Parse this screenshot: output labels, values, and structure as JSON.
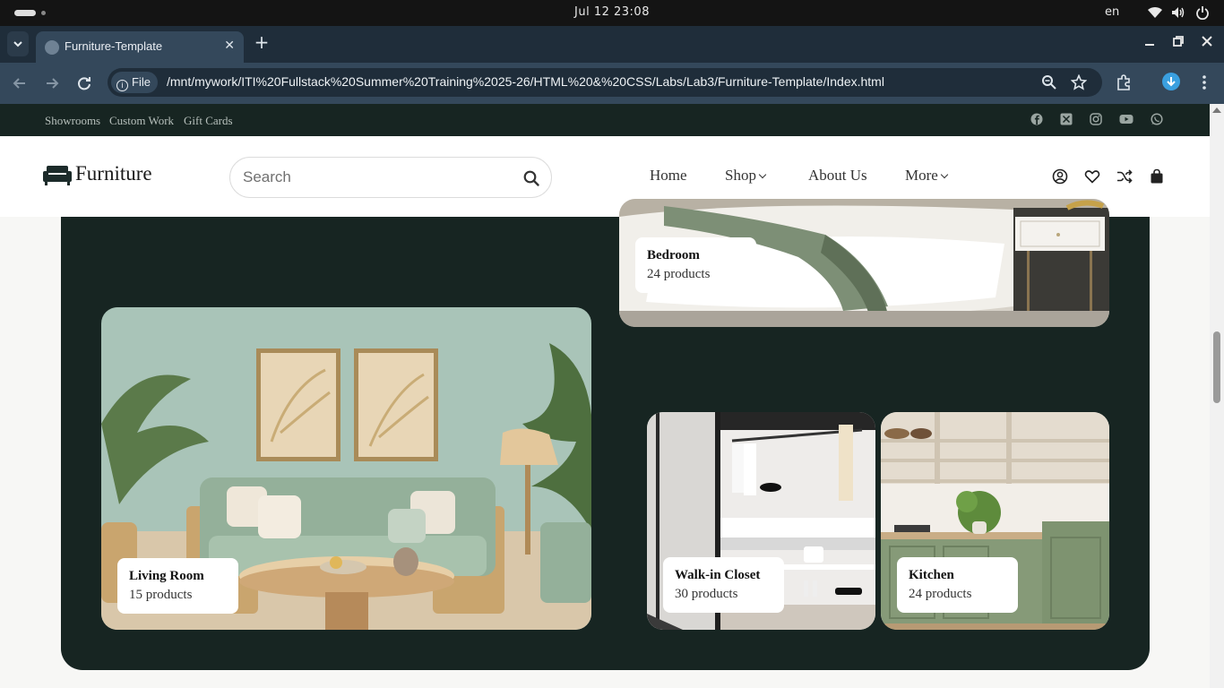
{
  "os": {
    "clock": "Jul 12  23:08",
    "language": "en"
  },
  "browser": {
    "tab_title": "Furniture-Template",
    "new_tab_symbol": "+",
    "close_symbol": "✕",
    "site_chip": "File",
    "url": "/mnt/mywork/ITI%20Fullstack%20Summer%20Training%2025-26/HTML%20&%20CSS/Labs/Lab3/Furniture-Template/Index.html"
  },
  "site": {
    "top_links": [
      "Showrooms",
      "Custom Work",
      "Gift Cards"
    ],
    "social_icons": [
      "facebook-icon",
      "x-icon",
      "instagram-icon",
      "youtube-icon",
      "whatsapp-icon"
    ],
    "logo_text": "Furniture",
    "search_placeholder": "Search",
    "nav": {
      "home": "Home",
      "shop": "Shop",
      "about": "About Us",
      "more": "More"
    },
    "colors": {
      "dark_green": "#172522",
      "panel": "#172522"
    }
  },
  "categories": {
    "bedroom": {
      "title": "Bedroom",
      "count": "24 products"
    },
    "living_room": {
      "title": "Living Room",
      "count": "15 products"
    },
    "walk_in_closet": {
      "title": "Walk-in Closet",
      "count": "30 products"
    },
    "kitchen": {
      "title": "Kitchen",
      "count": "24 products"
    }
  }
}
